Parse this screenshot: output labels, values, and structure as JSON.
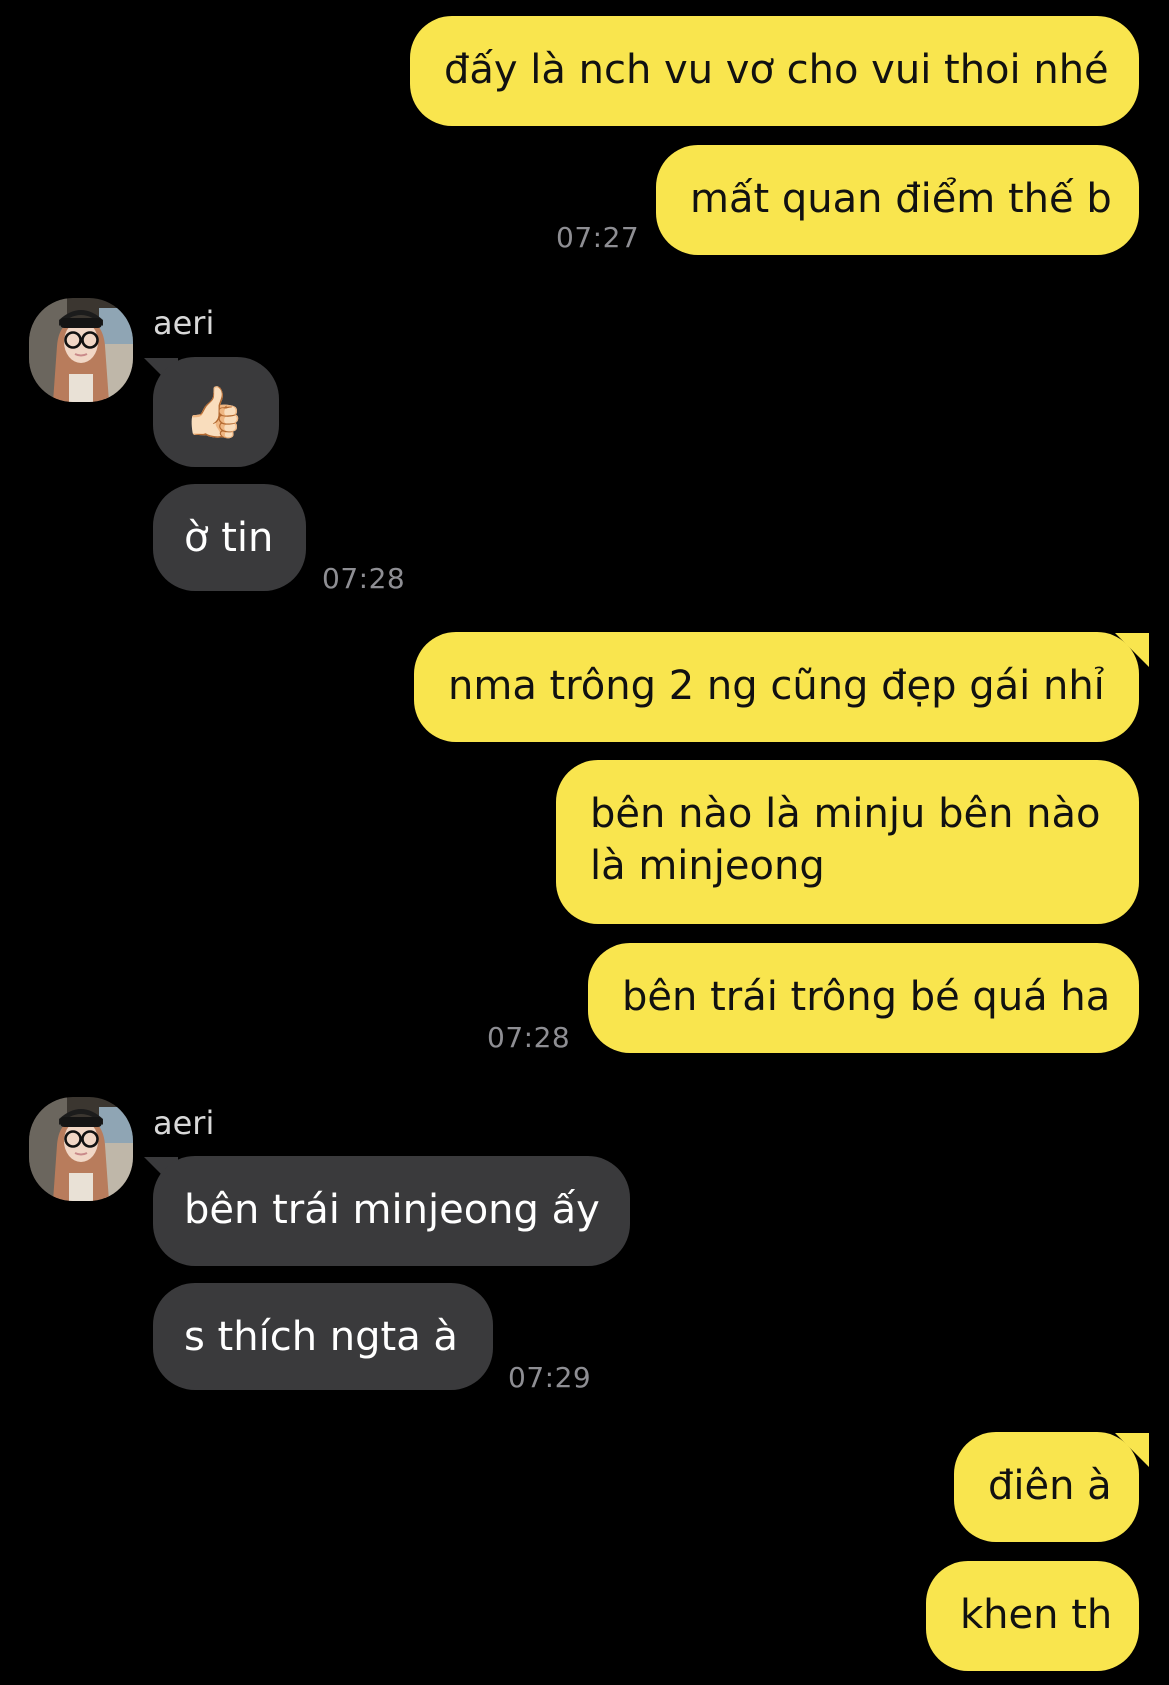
{
  "colors": {
    "background": "#000000",
    "sent_bubble": "#f9e54e",
    "received_bubble": "#3a3a3c",
    "timestamp": "#8e8e93"
  },
  "messages": [
    {
      "side": "sent",
      "text": "đấy là nch vu vơ cho vui thoi nhé"
    },
    {
      "side": "sent",
      "text": "mất quan điểm thế b",
      "time": "07:27"
    },
    {
      "side": "received",
      "sender": "aeri",
      "avatar_icon": "avatar-photo-icon",
      "text": "👍🏻"
    },
    {
      "side": "received",
      "text": "ờ tin",
      "time": "07:28"
    },
    {
      "side": "sent",
      "text": "nma trông 2 ng cũng đẹp gái nhỉ"
    },
    {
      "side": "sent",
      "text": "bên nào là minju bên nào là minjeong"
    },
    {
      "side": "sent",
      "text": "bên trái trông bé quá ha",
      "time": "07:28"
    },
    {
      "side": "received",
      "sender": "aeri",
      "avatar_icon": "avatar-photo-icon",
      "text": "bên trái minjeong ấy"
    },
    {
      "side": "received",
      "text": "s thích ngta à",
      "time": "07:29"
    },
    {
      "side": "sent",
      "text": "điên à"
    },
    {
      "side": "sent",
      "text": "khen th"
    }
  ]
}
